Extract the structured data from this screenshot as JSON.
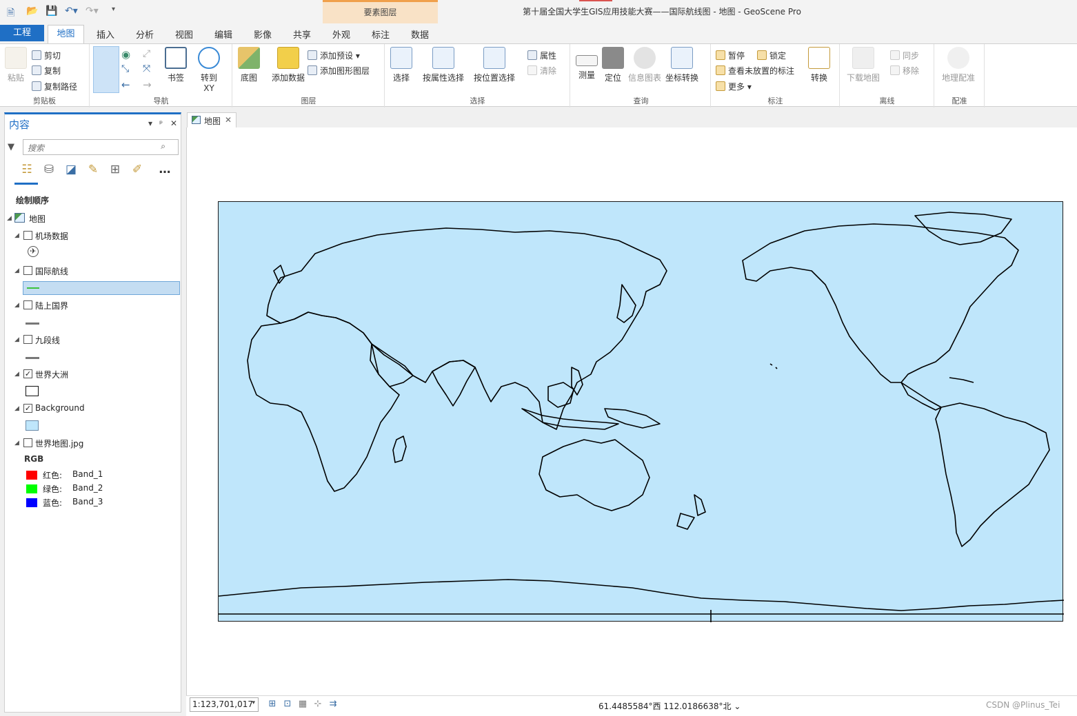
{
  "window": {
    "title": "第十届全国大学生GIS应用技能大赛——国际航线图 - 地图 - GeoScene Pro",
    "context_tab_group": "要素图层"
  },
  "tabs": {
    "project": "工程",
    "map": "地图",
    "insert": "插入",
    "analysis": "分析",
    "view": "视图",
    "edit": "编辑",
    "imagery": "影像",
    "share": "共享",
    "appearance": "外观",
    "labeling": "标注",
    "data": "数据"
  },
  "ribbon": {
    "clipboard": {
      "label": "剪贴板",
      "paste": "粘贴",
      "cut": "剪切",
      "copy": "复制",
      "copy_path": "复制路径"
    },
    "navigate": {
      "label": "导航",
      "explore": "浏览",
      "bookmarks": "书签",
      "goto": "转到",
      "goto_sub": "XY"
    },
    "layer": {
      "label": "图层",
      "basemap": "底图",
      "add_data": "添加数据",
      "add_preset": "添加预设",
      "add_graphics": "添加图形图层"
    },
    "selection": {
      "label": "选择",
      "select": "选择",
      "by_attr": "按属性选择",
      "by_loc": "按位置选择",
      "attributes": "属性",
      "clear": "清除"
    },
    "inquiry": {
      "label": "查询",
      "measure": "测量",
      "locate": "定位",
      "infographics": "信息图表",
      "convert_coords": "坐标转换"
    },
    "labeling": {
      "label": "标注",
      "pause": "暂停",
      "lock": "锁定",
      "unplaced": "查看未放置的标注",
      "more": "更多",
      "convert": "转换"
    },
    "offline": {
      "label": "离线",
      "download": "下载地图",
      "sync": "同步",
      "remove": "移除"
    },
    "georef": {
      "label": "配准",
      "georeference": "地理配准"
    }
  },
  "contents": {
    "title": "内容",
    "search_placeholder": "搜索",
    "drawing_order": "绘制顺序",
    "map_node": "地图",
    "layers": [
      {
        "name": "机场数据",
        "checked": false
      },
      {
        "name": "国际航线",
        "checked": false
      },
      {
        "name": "陆上国界",
        "checked": false
      },
      {
        "name": "九段线",
        "checked": false
      },
      {
        "name": "世界大洲",
        "checked": true
      },
      {
        "name": "Background",
        "checked": true
      },
      {
        "name": "世界地图.jpg",
        "checked": false
      }
    ],
    "rgb": {
      "title": "RGB",
      "bands": [
        {
          "channel": "红色:",
          "band": "Band_1",
          "color": "#ff0000"
        },
        {
          "channel": "绿色:",
          "band": "Band_2",
          "color": "#00ff00"
        },
        {
          "channel": "蓝色:",
          "band": "Band_3",
          "color": "#0000ff"
        }
      ]
    },
    "ocean_color": "#bfe6fb",
    "route_color": "#3cc23c"
  },
  "map_view": {
    "tab": "地图",
    "scale": "1:123,701,017",
    "coordinates": "61.4485584°西 112.0186638°北",
    "watermark": "CSDN @Plinus_Tei"
  },
  "checkmark": "✓"
}
